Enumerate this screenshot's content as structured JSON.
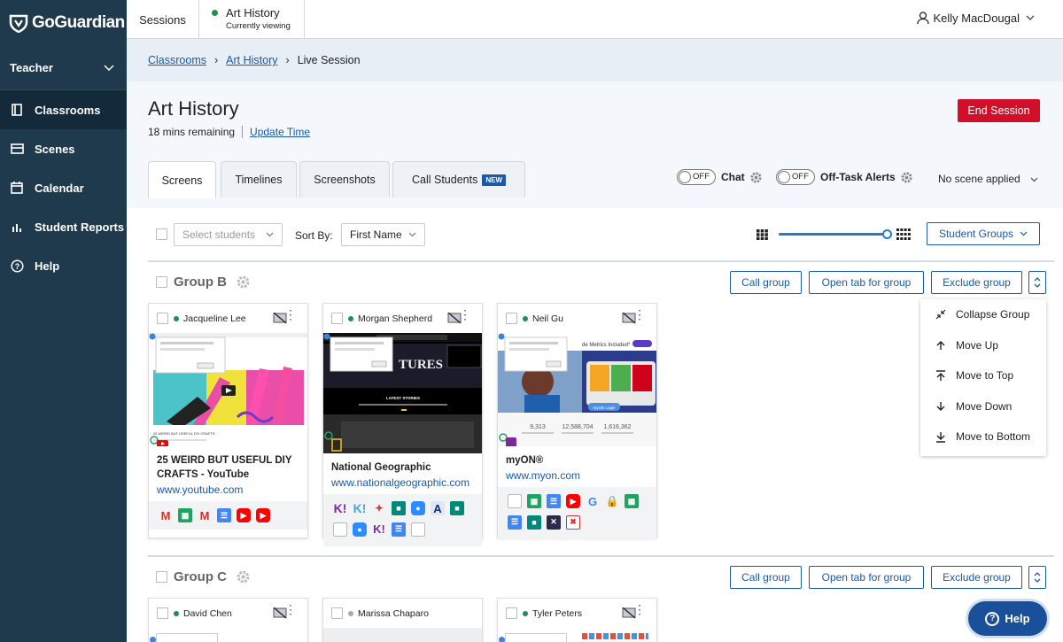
{
  "brand": "GoGuardian",
  "sidebar": {
    "role": "Teacher",
    "items": [
      {
        "label": "Classrooms"
      },
      {
        "label": "Scenes"
      },
      {
        "label": "Calendar"
      },
      {
        "label": "Student Reports"
      },
      {
        "label": "Help"
      }
    ]
  },
  "topbar": {
    "sessions_label": "Sessions",
    "current_title": "Art History",
    "current_sub": "Currently viewing",
    "user_name": "Kelly MacDougal"
  },
  "breadcrumb": {
    "items": [
      "Classrooms",
      "Art History"
    ],
    "current": "Live Session"
  },
  "header": {
    "title": "Art History",
    "remaining": "18 mins remaining",
    "update_time": "Update Time",
    "end_session": "End Session"
  },
  "tabs": [
    "Screens",
    "Timelines",
    "Screenshots",
    "Call Students"
  ],
  "tab_badge": "NEW",
  "toggles": {
    "off_text": "OFF",
    "chat_label": "Chat",
    "offtask_label": "Off-Task Alerts"
  },
  "scene": "No scene applied",
  "toolbar": {
    "select_students_placeholder": "Select students",
    "sort_by_label": "Sort By:",
    "sort_value": "First Name",
    "student_groups": "Student Groups"
  },
  "group_actions": {
    "call": "Call group",
    "open_tab": "Open tab for group",
    "exclude": "Exclude group"
  },
  "groups": [
    {
      "name": "Group B",
      "students": [
        {
          "name": "Jacqueline Lee",
          "title": "25 WEIRD BUT USEFUL DIY CRAFTS - YouTube",
          "url": "www.youtube.com"
        },
        {
          "name": "Morgan Shepherd",
          "title": "National Geographic",
          "url": "www.nationalgeographic.com"
        },
        {
          "name": "Neil Gu",
          "title": "myON®",
          "url": "www.myon.com"
        }
      ]
    },
    {
      "name": "Group C",
      "students": [
        {
          "name": "David Chen"
        },
        {
          "name": "Marissa Chaparo"
        },
        {
          "name": "Tyler Peters"
        }
      ]
    }
  ],
  "shot_text": {
    "yt_caption": "25 WEIRD BUT USEFUL DIY CRAFTS",
    "natgeo_banner": "TURES",
    "natgeo_latest": "LATEST STORIES",
    "myon_banner": "de Metrics Included*",
    "myon_stats": [
      "9,313",
      "12,588,704",
      "1,616,362"
    ],
    "myon_logo": "myON Login"
  },
  "menu": [
    "Collapse Group",
    "Move Up",
    "Move to Top",
    "Move Down",
    "Move to Bottom"
  ],
  "help_label": "Help",
  "colors": {
    "sidebar": "#1f3a4d",
    "accent": "#1a5aa8",
    "danger": "#d0102a",
    "online": "#1f8f4f"
  }
}
